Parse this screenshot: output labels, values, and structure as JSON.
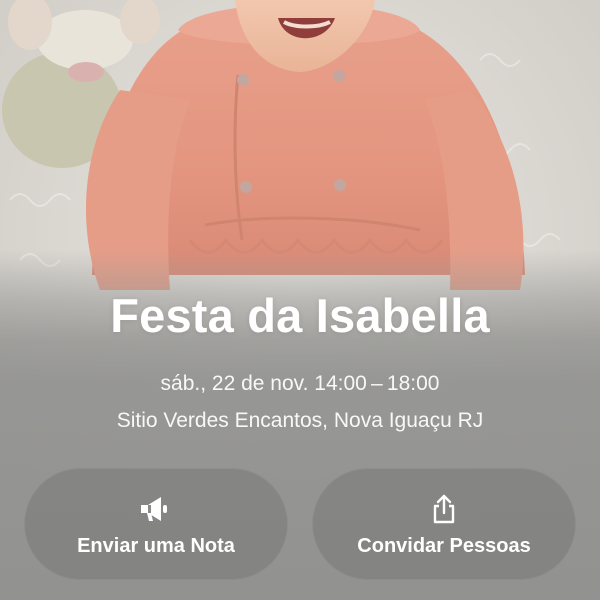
{
  "event": {
    "title": "Festa da Isabella",
    "datetime": "sáb., 22 de nov. 14:00 – 18:00",
    "location": "Sitio Verdes Encantos, Nova Iguaçu RJ"
  },
  "actions": [
    {
      "label": "Enviar uma Nota",
      "icon": "megaphone-icon"
    },
    {
      "label": "Convidar Pessoas",
      "icon": "share-icon"
    }
  ],
  "colors": {
    "text": "#ffffff",
    "outfit": "#e59a84",
    "button_fill": "#7c7c7a"
  }
}
